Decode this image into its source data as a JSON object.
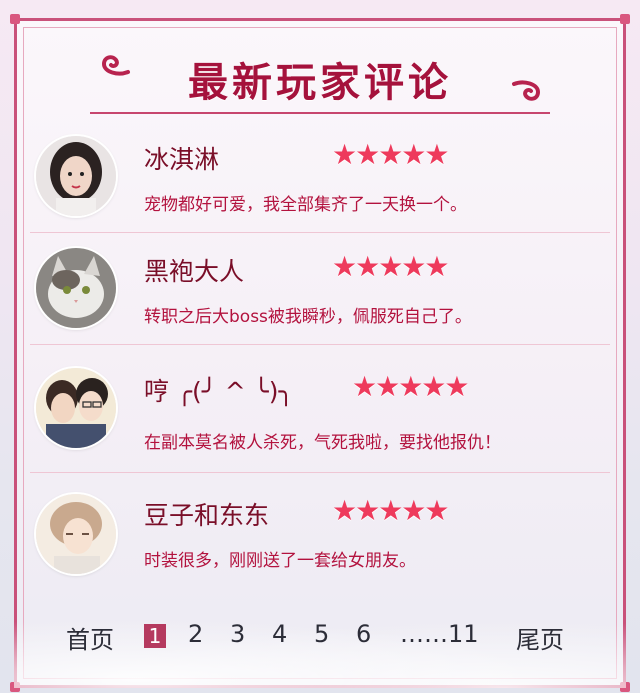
{
  "title": "最新玩家评论",
  "comments": [
    {
      "name": "冰淇淋",
      "stars": "★★★★★",
      "text": "宠物都好可爱，我全部集齐了一天换一个。",
      "avatar": "female-portrait-avatar"
    },
    {
      "name": "黑袍大人",
      "stars": "★★★★★",
      "text": "转职之后大boss被我瞬秒，佩服死自己了。",
      "avatar": "cat-avatar"
    },
    {
      "name": "哼 ╭(╯ ^ ╰)╮",
      "stars": "★★★★★",
      "text": "在副本莫名被人杀死，气死我啦，要找他报仇！",
      "avatar": "anime-couple-avatar"
    },
    {
      "name": "豆子和东东",
      "stars": "★★★★★",
      "text": "时装很多，刚刚送了一套给女朋友。",
      "avatar": "anime-boy-avatar"
    }
  ],
  "pagination": {
    "first": "首页",
    "pages": [
      "1",
      "2",
      "3",
      "4",
      "5",
      "6"
    ],
    "active": "1",
    "ellipsis_last": "……11",
    "last": "尾页"
  },
  "colors": {
    "accent": "#a5123c",
    "border": "#c9517a",
    "star": "#ee3a5c"
  }
}
